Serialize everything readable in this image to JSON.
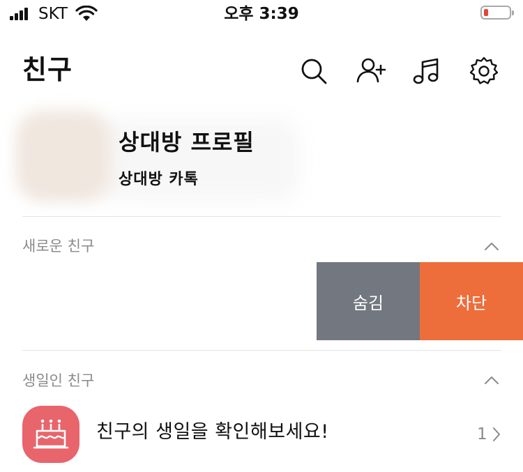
{
  "status_bar": {
    "carrier": "SKT",
    "time": "오후 3:39",
    "battery_level": 0.1
  },
  "header": {
    "title": "친구",
    "icons": [
      "search-icon",
      "add-friend-icon",
      "music-icon",
      "settings-icon"
    ]
  },
  "profile": {
    "name": "상대방 프로필",
    "status_message": "상대방 카톡"
  },
  "sections": {
    "new_friends": {
      "title": "새로운 친구",
      "hide_label": "숨김",
      "block_label": "차단"
    },
    "birthday_friends": {
      "title": "생일인 친구",
      "prompt": "친구의 생일을 확인해보세요!",
      "count": "1"
    }
  },
  "colors": {
    "hide_button": "#727780",
    "block_button": "#ed6d3b",
    "birthday_icon": "#e8656b"
  }
}
